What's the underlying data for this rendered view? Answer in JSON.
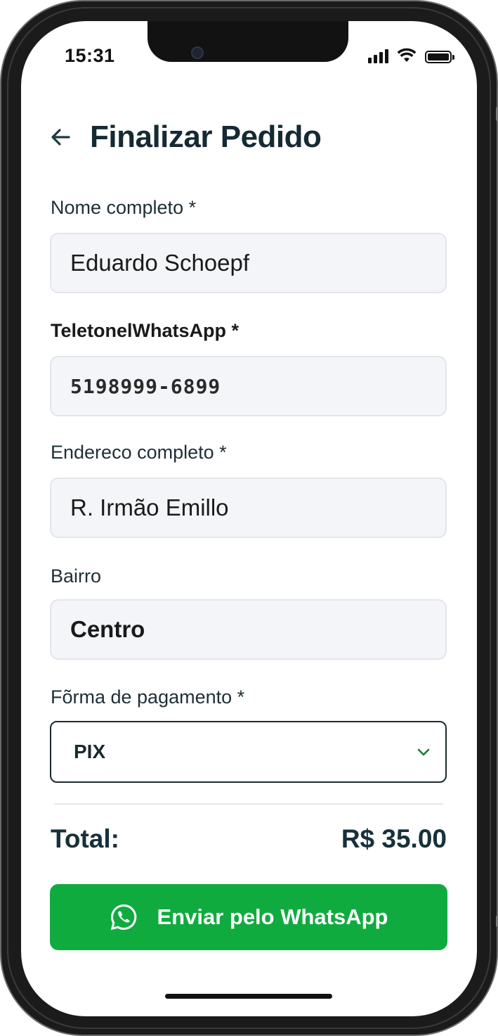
{
  "status_bar": {
    "time": "15:31",
    "icons": [
      "signal-icon",
      "wifi-icon",
      "battery-icon"
    ]
  },
  "header": {
    "back_icon": "arrow-left-icon",
    "title": "Finalizar Pedido"
  },
  "form": {
    "name": {
      "label": "Nome completo *",
      "value": "Eduardo Schoepf"
    },
    "phone": {
      "label": "TeletonelWhatsApp *",
      "value": "5198999-6899"
    },
    "address": {
      "label": "Endereco completo *",
      "value": "R. Irmão Emillo"
    },
    "neighborhood": {
      "label": "Bairro",
      "value": "Centro"
    },
    "payment": {
      "label": "Fõrma de pagamento *",
      "selected": "PIX",
      "icon": "chevron-down-icon"
    }
  },
  "summary": {
    "total_label": "Total:",
    "total_value": "R$ 35.00"
  },
  "actions": {
    "send_label": "Enviar pelo WhatsApp",
    "send_icon": "whatsapp-icon"
  },
  "colors": {
    "title": "#152a33",
    "accent_green": "#10ab3f",
    "chevron_green": "#1a7a33",
    "input_bg": "#f4f5f8",
    "input_border": "#e3e5ea"
  }
}
